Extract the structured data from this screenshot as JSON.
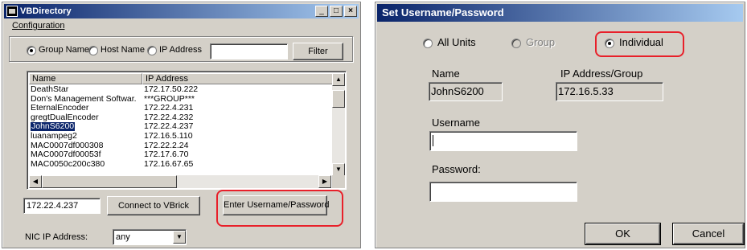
{
  "left_window": {
    "title": "VBDirectory",
    "menu": [
      "Configuration"
    ],
    "caption_buttons": [
      "minimize-icon",
      "maximize-icon",
      "close-icon"
    ],
    "filter": {
      "radio_group_name": "Group Name",
      "radio_host_name": "Host Name",
      "radio_ip_address": "IP Address",
      "selected": "Group Name",
      "input_value": "",
      "button_label": "Filter"
    },
    "list": {
      "columns": [
        "Name",
        "IP Address"
      ],
      "rows": [
        {
          "name": "DeathStar",
          "ip": "172.17.50.222"
        },
        {
          "name": "Don's Management Softwar...",
          "ip": "***GROUP***"
        },
        {
          "name": "EternalEncoder",
          "ip": "172.22.4.231"
        },
        {
          "name": "gregtDualEncoder",
          "ip": "172.22.4.232"
        },
        {
          "name": "JohnS6200",
          "ip": "172.22.4.237"
        },
        {
          "name": "luanampeg2",
          "ip": "172.16.5.110"
        },
        {
          "name": "MAC0007df000308",
          "ip": "172.22.2.24"
        },
        {
          "name": "MAC0007df00053f",
          "ip": "172.17.6.70"
        },
        {
          "name": "MAC0050c200c380",
          "ip": "172.16.67.65"
        }
      ],
      "selected_row": "JohnS6200"
    },
    "address_value": "172.22.4.237",
    "connect_label": "Connect to VBrick",
    "credentials_label": "Enter Username/Password",
    "nic_label": "NIC IP Address:",
    "nic_value": "any"
  },
  "right_window": {
    "title": "Set Username/Password",
    "scope": {
      "all_units": "All Units",
      "group": "Group",
      "individual": "Individual",
      "selected": "Individual",
      "group_disabled": true
    },
    "name_label": "Name",
    "name_value": "JohnS6200",
    "ip_label": "IP Address/Group",
    "ip_value": "172.16.5.33",
    "username_label": "Username",
    "username_value": "",
    "password_label": "Password:",
    "password_value": "",
    "ok_label": "OK",
    "cancel_label": "Cancel"
  },
  "colors": {
    "titlebar_start": "#0a246a",
    "titlebar_end": "#a6caf0",
    "dialog_face": "#d4d0c8",
    "highlight_outline": "#e8202a",
    "selection": "#0a246a"
  }
}
